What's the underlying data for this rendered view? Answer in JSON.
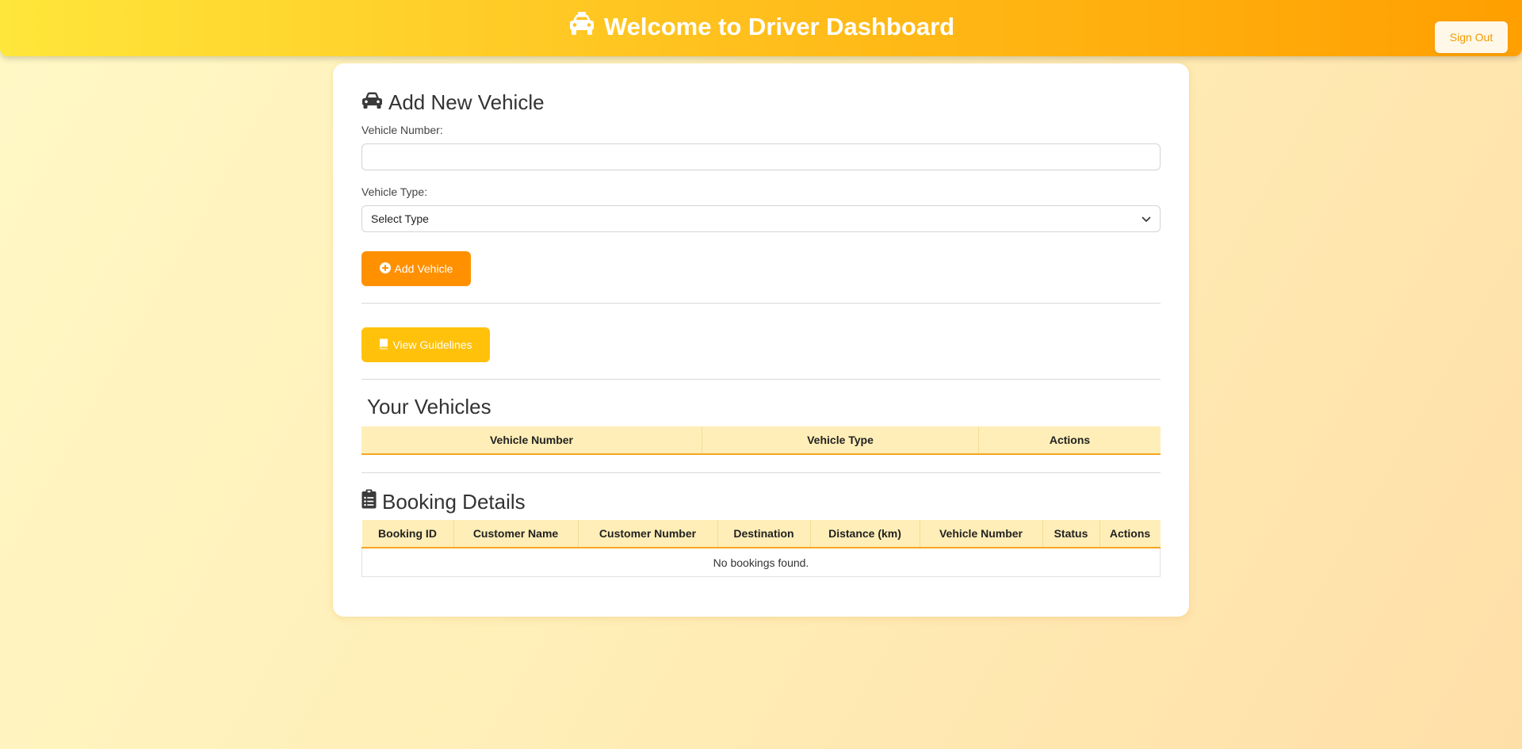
{
  "header": {
    "title": "Welcome to Driver Dashboard",
    "title_icon": "taxi-icon",
    "signout_label": "Sign Out"
  },
  "add_vehicle": {
    "title": "Add New Vehicle",
    "title_icon": "car-icon",
    "vehicle_number_label": "Vehicle Number:",
    "vehicle_number_value": "",
    "vehicle_type_label": "Vehicle Type:",
    "vehicle_type_selected": "Select Type",
    "add_button_label": "Add Vehicle",
    "add_button_icon": "plus-circle-icon"
  },
  "guidelines": {
    "button_label": "View Guidelines",
    "button_icon": "book-icon"
  },
  "vehicles": {
    "title": "Your Vehicles",
    "columns": [
      "Vehicle Number",
      "Vehicle Type",
      "Actions"
    ],
    "rows": []
  },
  "bookings": {
    "title": "Booking Details",
    "title_icon": "clipboard-list-icon",
    "columns": [
      "Booking ID",
      "Customer Name",
      "Customer Number",
      "Destination",
      "Distance (km)",
      "Vehicle Number",
      "Status",
      "Actions"
    ],
    "rows": [],
    "empty_message": "No bookings found."
  },
  "colors": {
    "accent_orange": "#ff9000",
    "accent_yellow": "#ffc10a",
    "table_header_bg": "#ffeeb7"
  }
}
